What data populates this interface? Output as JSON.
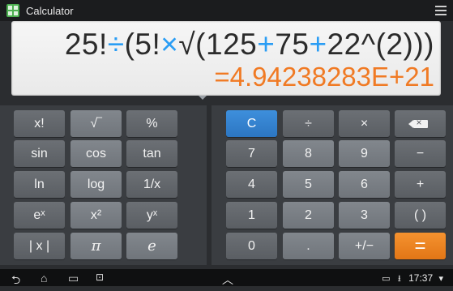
{
  "titlebar": {
    "app_title": "Calculator"
  },
  "display": {
    "expression": [
      {
        "t": "25!",
        "cls": ""
      },
      {
        "t": "÷",
        "cls": "op"
      },
      {
        "t": "(5!",
        "cls": ""
      },
      {
        "t": "×",
        "cls": "op"
      },
      {
        "t": "√(125",
        "cls": ""
      },
      {
        "t": "+",
        "cls": "op"
      },
      {
        "t": "75",
        "cls": ""
      },
      {
        "t": "+",
        "cls": "op"
      },
      {
        "t": "22^(2))",
        "cls": ""
      },
      {
        "t": ")",
        "cls": ""
      }
    ],
    "result": "=4.94238283E+21"
  },
  "left_keys": [
    [
      "x!",
      "√‾",
      "%"
    ],
    [
      "sin",
      "cos",
      "tan"
    ],
    [
      "ln",
      "log",
      "1/x"
    ],
    [
      "eˣ",
      "x²",
      "yˣ"
    ],
    [
      "| x |",
      "π",
      "e"
    ]
  ],
  "right_keys": [
    [
      "C",
      "÷",
      "×",
      ""
    ],
    [
      "7",
      "8",
      "9",
      "−"
    ],
    [
      "4",
      "5",
      "6",
      "+"
    ],
    [
      "1",
      "2",
      "3",
      "( )"
    ],
    [
      "0",
      ".",
      "+/−",
      "="
    ]
  ],
  "navbar": {
    "time": "17:37",
    "icons": [
      "back-icon",
      "home-icon",
      "recent-apps-icon",
      "screenshot-icon",
      "up-chevron-icon"
    ]
  },
  "colors": {
    "operator": "#2a9df4",
    "result": "#f07a24",
    "clear_key": "#2c76c2",
    "equals_key": "#e27616"
  }
}
